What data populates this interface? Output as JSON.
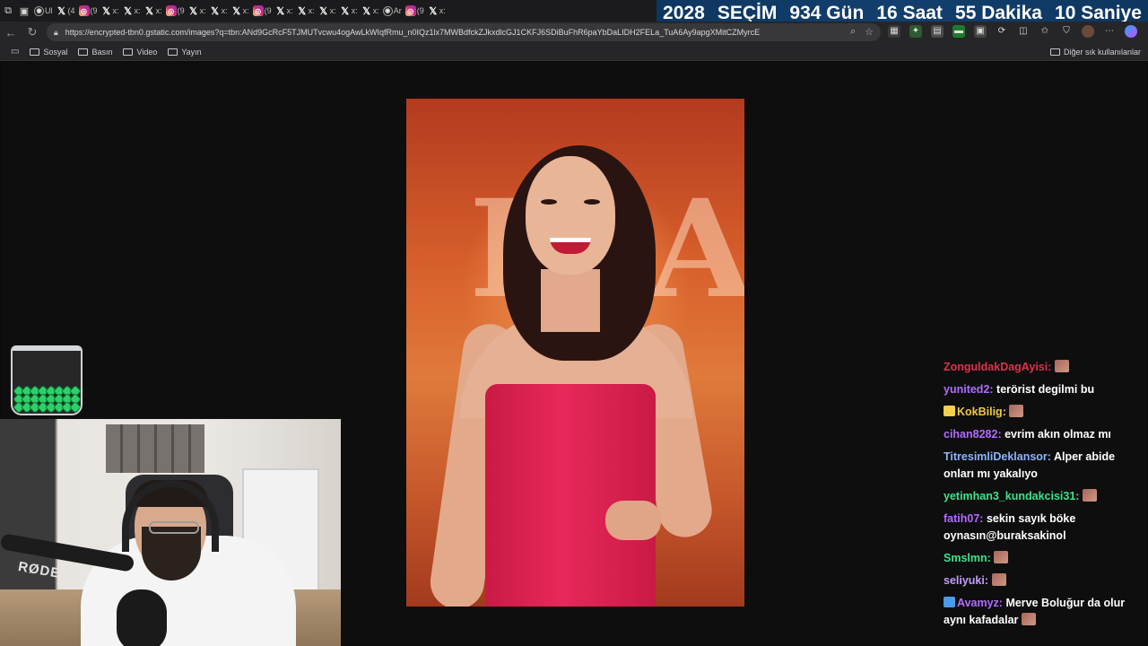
{
  "tabs": {
    "items": [
      {
        "icon": "tab-manager-icon",
        "glyph": "⧉"
      },
      {
        "icon": "sidebar-icon",
        "glyph": "▣"
      }
    ],
    "mini": [
      {
        "label": "Ul",
        "fav": "shield",
        "type": "g"
      },
      {
        "label": "(4",
        "fav": "x",
        "type": "x"
      },
      {
        "label": "(9",
        "fav": "ig",
        "type": "ig"
      },
      {
        "label": "x:",
        "fav": "x",
        "type": "x"
      },
      {
        "label": "x:",
        "fav": "x",
        "type": "x"
      },
      {
        "label": "x:",
        "fav": "x",
        "type": "x"
      },
      {
        "label": "(9",
        "fav": "ig",
        "type": "ig"
      },
      {
        "label": "x:",
        "fav": "x",
        "type": "x"
      },
      {
        "label": "x:",
        "fav": "x",
        "type": "x"
      },
      {
        "label": "x:",
        "fav": "x",
        "type": "x"
      },
      {
        "label": "(9",
        "fav": "ig",
        "type": "ig"
      },
      {
        "label": "x:",
        "fav": "x",
        "type": "x"
      },
      {
        "label": "x:",
        "fav": "x",
        "type": "x"
      },
      {
        "label": "x:",
        "fav": "x",
        "type": "x"
      },
      {
        "label": "x:",
        "fav": "x",
        "type": "x"
      },
      {
        "label": "x:",
        "fav": "x",
        "type": "x"
      },
      {
        "label": "Ar",
        "fav": "g",
        "type": "g"
      },
      {
        "label": "(9",
        "fav": "ig",
        "type": "ig"
      },
      {
        "label": "x:",
        "fav": "x",
        "type": "x"
      }
    ]
  },
  "countdown": {
    "year": "2028",
    "event": "SEÇİM",
    "days": "934 Gün",
    "hours": "16 Saat",
    "minutes": "55 Dakika",
    "seconds": "10 Saniye"
  },
  "address_bar": {
    "url": "https://encrypted-tbn0.gstatic.com/images?q=tbn:ANd9GcRcF5TJMUTvcwu4ogAwLkWIqfRmu_n0IQz1lx7MWBdfckZJkxdlcGJ1CKFJ6SDiBuFhR6paYbDaLIDH2FELa_TuA6Ay9apgXMitCZMyrcE"
  },
  "bookmarks": {
    "items": [
      "Sosyal",
      "Basın",
      "Video",
      "Yayın"
    ],
    "other": "Diğer sık kullanılanlar"
  },
  "chat": {
    "messages": [
      {
        "user": "ZonguldakDagAyisi:",
        "color": "#e0314b",
        "text": "",
        "emote": true,
        "badge": false
      },
      {
        "user": "yunited2:",
        "color": "#b26bff",
        "text": "terörist degilmi bu",
        "emote": false,
        "badge": false
      },
      {
        "user": "KokBilig:",
        "color": "#f0c74a",
        "text": "",
        "emote": true,
        "badge": true
      },
      {
        "user": "cihan8282:",
        "color": "#b26bff",
        "text": "evrim akın olmaz mı",
        "emote": false,
        "badge": false
      },
      {
        "user": "TitresimliDeklansor:",
        "color": "#8ab4ff",
        "text": "Alper abide onları mı yakalıyo",
        "emote": false,
        "badge": false
      },
      {
        "user": "yetimhan3_kundakcisi31:",
        "color": "#3ce38c",
        "text": "",
        "emote": true,
        "badge": false
      },
      {
        "user": "fatih07:",
        "color": "#b26bff",
        "text": "sekin sayık böke oynasın@buraksakinol",
        "emote": false,
        "badge": false
      },
      {
        "user": "Smslmn:",
        "color": "#3ce38c",
        "text": "",
        "emote": true,
        "badge": false
      },
      {
        "user": "seliyuki:",
        "color": "#c49cff",
        "text": "",
        "emote": true,
        "badge": false
      },
      {
        "user": "Avamyz:",
        "color": "#b26bff",
        "text": "Merve Boluğur da olur aynı kafadalar",
        "emote": true,
        "badge": true
      }
    ]
  },
  "webcam": {
    "mic_brand": "RØDE"
  }
}
